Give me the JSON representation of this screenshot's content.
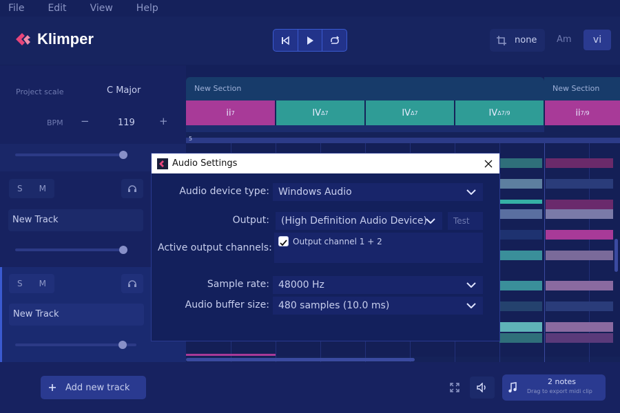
{
  "menu": {
    "file": "File",
    "edit": "Edit",
    "view": "View",
    "help": "Help"
  },
  "app": {
    "name": "Klimper"
  },
  "header": {
    "chord_display": "none",
    "key_Am": "Am",
    "key_vi": "vi"
  },
  "project": {
    "scale_label": "Project scale",
    "scale_value": "C Major",
    "bpm_label": "BPM",
    "bpm_value": "119",
    "bpm_minus": "−",
    "bpm_plus": "+"
  },
  "tracks": [
    {
      "s": "S",
      "m": "M",
      "name": "New Track",
      "volume": 0.86
    },
    {
      "s": "S",
      "m": "M",
      "name": "New Track",
      "volume": 0.86
    }
  ],
  "top_volume": 0.86,
  "sections": [
    {
      "label": "New Section"
    },
    {
      "label": "New Section"
    }
  ],
  "chords": [
    {
      "base": "ii",
      "sup": "7"
    },
    {
      "base": "IV",
      "sup": "Δ7"
    },
    {
      "base": "IV",
      "sup": "Δ7"
    },
    {
      "base": "IV",
      "sup": "Δ7/9"
    },
    {
      "base": "ii",
      "sup": "7/9"
    }
  ],
  "ruler_marker": "5",
  "dialog": {
    "title": "Audio Settings",
    "device_type_label": "Audio device type:",
    "device_type_value": "Windows Audio",
    "output_label": "Output:",
    "output_value": "(High Definition Audio Device)",
    "test_label": "Test",
    "channels_label": "Active output channels:",
    "channel_option": "Output channel 1 + 2",
    "sample_rate_label": "Sample rate:",
    "sample_rate_value": "48000 Hz",
    "buffer_label": "Audio buffer size:",
    "buffer_value": "480 samples (10.0 ms)"
  },
  "bottom": {
    "add_track": "Add new track",
    "notes_count": "2 notes",
    "export_hint": "Drag to export midi clip"
  },
  "colors": {
    "magenta": "#a83a98",
    "teal": "#2f9c96",
    "accent": "#3a5ad0"
  }
}
